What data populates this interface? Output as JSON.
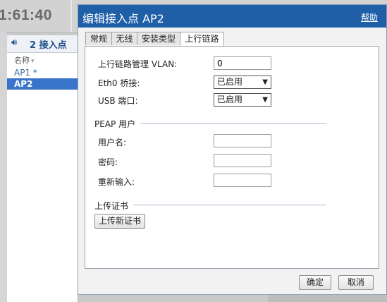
{
  "background": {
    "clock": "1:61:40",
    "panel_title": "2 接入点",
    "column_header": "名称",
    "rows": [
      "AP1 *",
      "AP2"
    ]
  },
  "dialog": {
    "title": "编辑接入点 AP2",
    "help": "帮助",
    "tabs": [
      "常规",
      "无线",
      "安装类型",
      "上行链路"
    ],
    "active_tab": "上行链路",
    "fields": {
      "vlan_label": "上行链路管理 VLAN:",
      "vlan_value": "0",
      "eth0_label": "Eth0 桥接:",
      "eth0_value": "已启用",
      "usb_label": "USB 端口:",
      "usb_value": "已启用"
    },
    "peap": {
      "section": "PEAP 用户",
      "username_label": "用户名:",
      "username_value": "",
      "password_label": "密码:",
      "password_value": "",
      "reenter_label": "重新输入:",
      "reenter_value": ""
    },
    "cert": {
      "section": "上传证书",
      "upload_button": "上传新证书"
    },
    "ok_button": "确定",
    "cancel_button": "取消"
  },
  "colors": {
    "title_bar": "#1f5fa8",
    "selection": "#3a74c9",
    "panel_title": "#1f4f8a"
  }
}
